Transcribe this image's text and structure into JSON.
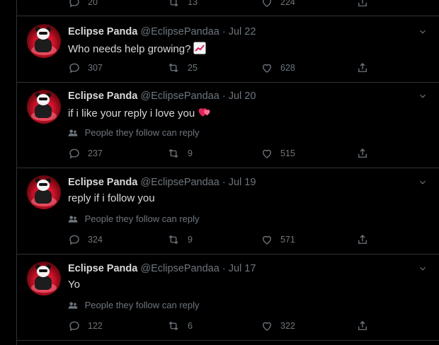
{
  "colors": {
    "background": "#000000",
    "text": "#d9d9d9",
    "muted": "#6e767d",
    "border": "#2f3336",
    "growth_emoji": "#e0245e",
    "heart_emoji": "#e0245e"
  },
  "top_partial": {
    "replies": "20",
    "retweets": "13",
    "likes": "224"
  },
  "restriction_text": "People they follow can reply",
  "tweets": [
    {
      "name": "Eclipse Panda",
      "handle": "@EclipsePandaa",
      "sep": "·",
      "date": "Jul 22",
      "text": "Who needs help growing?",
      "emoji": "chart-increasing-icon",
      "replies": "307",
      "retweets": "25",
      "likes": "628",
      "restricted": false
    },
    {
      "name": "Eclipse Panda",
      "handle": "@EclipsePandaa",
      "sep": "·",
      "date": "Jul 20",
      "text": "if i like your reply i love you",
      "emoji": "heart-icon",
      "replies": "237",
      "retweets": "9",
      "likes": "515",
      "restricted": true
    },
    {
      "name": "Eclipse Panda",
      "handle": "@EclipsePandaa",
      "sep": "·",
      "date": "Jul 19",
      "text": "reply if i follow you",
      "emoji": "",
      "replies": "324",
      "retweets": "9",
      "likes": "571",
      "restricted": true
    },
    {
      "name": "Eclipse Panda",
      "handle": "@EclipsePandaa",
      "sep": "·",
      "date": "Jul 17",
      "text": "Yo",
      "emoji": "",
      "replies": "122",
      "retweets": "6",
      "likes": "322",
      "restricted": true
    }
  ]
}
